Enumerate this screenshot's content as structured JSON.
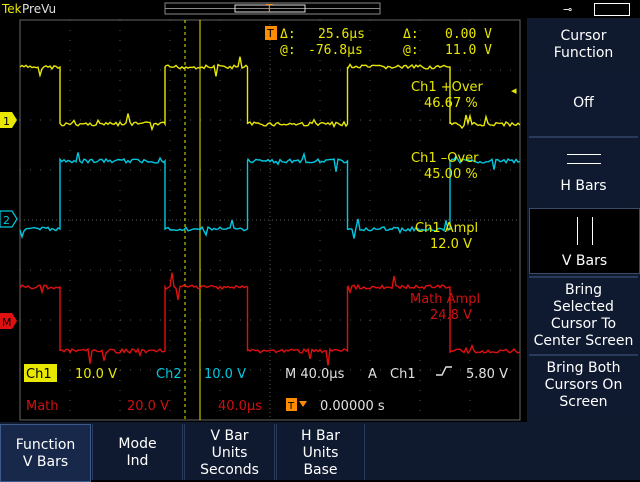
{
  "header": {
    "brand": "Tek",
    "mode": "PreVu"
  },
  "cursor_readouts": {
    "delta_time": "25.6µs",
    "delta_volt": "0.00 V",
    "at_time": "-76.8µs",
    "at_volt": "11.0 V",
    "delta_symbol": "Δ:",
    "at_symbol": "@:"
  },
  "measurements": [
    {
      "label": "Ch1 +Over",
      "value": "46.67 %",
      "color": "#e0e000"
    },
    {
      "label": "Ch1 –Over",
      "value": "45.00 %",
      "color": "#e0e000"
    },
    {
      "label": "Ch1 Ampl",
      "value": "12.0 V",
      "color": "#e0e000"
    },
    {
      "label": "Math Ampl",
      "value": "24.8 V",
      "color": "#d01010"
    }
  ],
  "status": {
    "ch1_label": "Ch1",
    "ch1_scale": "10.0 V",
    "ch2_label": "Ch2",
    "ch2_scale": "10.0 V",
    "timebase": "M 40.0µs",
    "acq": "A",
    "trig_src": "Ch1",
    "trig_level": "5.80 V",
    "math_label": "Math",
    "math_scale": "20.0 V",
    "math_time": "40.0µs",
    "trig_pos": "0.00000 s"
  },
  "channel_markers": {
    "ch1": "1",
    "ch2": "2",
    "math": "M"
  },
  "side_menu": {
    "title_line1": "Cursor",
    "title_line2": "Function",
    "off": "Off",
    "hbars": "H Bars",
    "vbars": "V Bars",
    "bring_selected": [
      "Bring",
      "Selected",
      "Cursor To",
      "Center Screen"
    ],
    "bring_both": [
      "Bring Both",
      "Cursors On",
      "Screen"
    ]
  },
  "bottom_menu": [
    {
      "line1": "Function",
      "line2": "V Bars",
      "line3": ""
    },
    {
      "line1": "Mode",
      "line2": "Ind",
      "line3": ""
    },
    {
      "line1": "V Bar",
      "line2": "Units",
      "line3": "Seconds"
    },
    {
      "line1": "H Bar",
      "line2": "Units",
      "line3": "Base"
    }
  ],
  "colors": {
    "ch1": "#e8e800",
    "ch2": "#00c8e0",
    "math": "#e01010",
    "grid": "#555555",
    "trigger": "#ff8c00"
  },
  "waveforms": {
    "ch1": {
      "high_level": 11.0,
      "low_level": -1.0,
      "edges": [
        0.08,
        0.29,
        0.455,
        0.655,
        0.86
      ]
    },
    "ch2_level_note": "",
    "cursor_times_fraction": [
      0.33,
      0.36
    ]
  }
}
